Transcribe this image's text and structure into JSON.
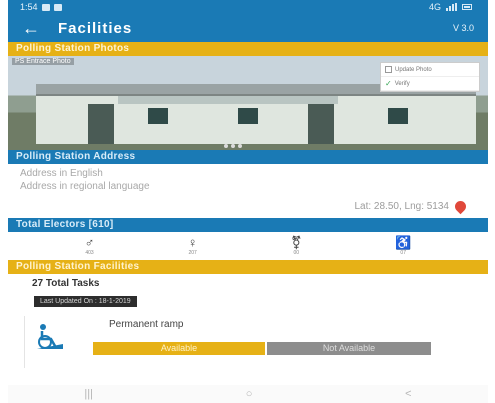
{
  "status_bar": {
    "time": "1:54",
    "network": "4G"
  },
  "app_bar": {
    "back_icon": "arrow-left-icon",
    "title": "Facilities",
    "version": "V 3.0"
  },
  "photos": {
    "header": "Polling Station Photos",
    "photo_label": "PS Entrace Photo",
    "verify_options": [
      "Update Photo",
      "Verify"
    ]
  },
  "address": {
    "header": "Polling Station Address",
    "english": "Address in English",
    "regional": "Address in regional language",
    "latlng": "Lat: 28.50, Lng: 5134"
  },
  "electors": {
    "header": "Total Electors [610]",
    "items": [
      {
        "icon": "male-icon",
        "label": "403"
      },
      {
        "icon": "female-icon",
        "label": "207"
      },
      {
        "icon": "third-gender-icon",
        "label": "00"
      },
      {
        "icon": "pwd-icon",
        "label": "07"
      }
    ]
  },
  "facilities": {
    "header": "Polling Station Facilities",
    "total": "27 Total Tasks",
    "last_updated": "Last Updated On : 18-1-2019",
    "items": [
      {
        "name": "Permanent ramp",
        "available_label": "Available",
        "not_available_label": "Not Available"
      }
    ]
  },
  "colors": {
    "primary": "#1a7ab5",
    "accent": "#e6b116",
    "inactive": "#8d8d8d"
  }
}
